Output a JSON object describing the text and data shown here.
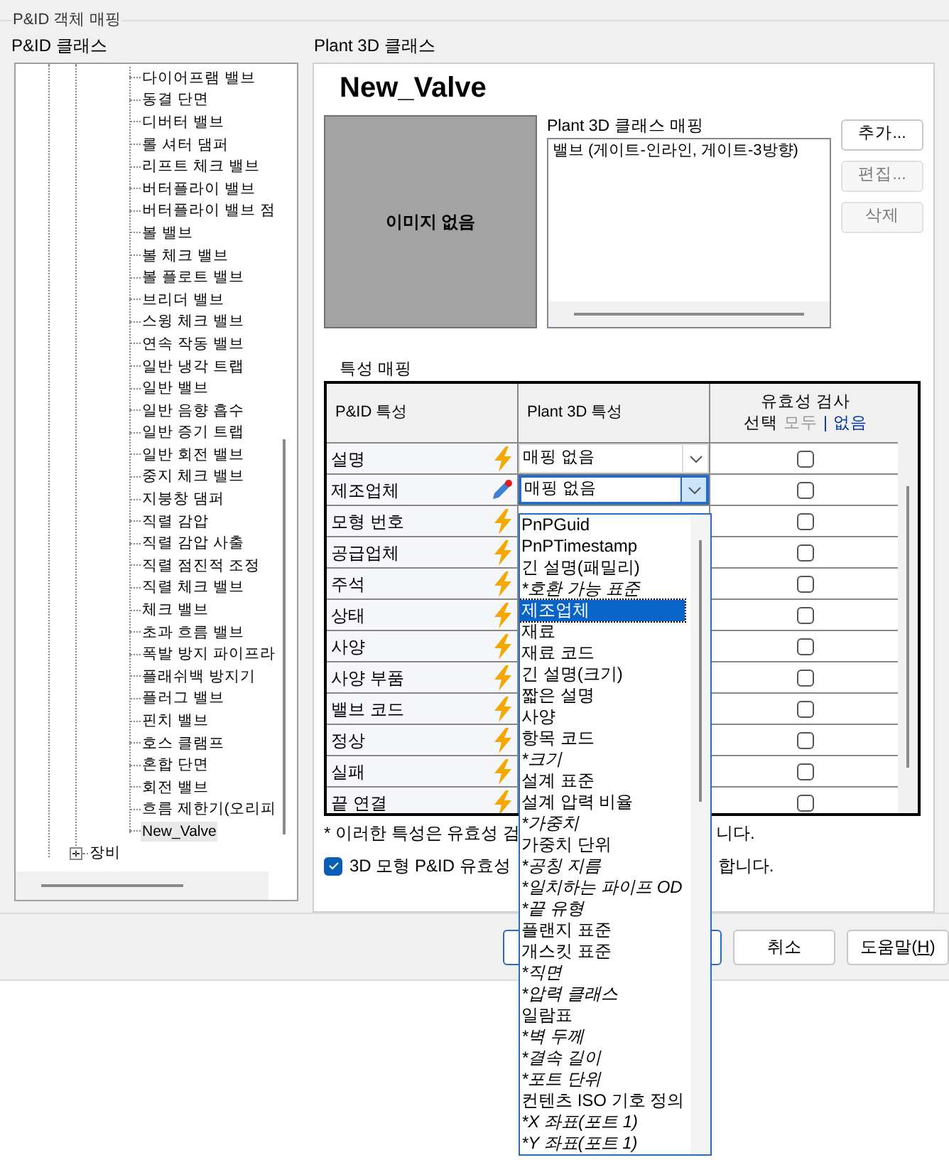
{
  "group_title": "P&ID 객체 매핑",
  "left": {
    "label": "P&ID 클래스",
    "tree": [
      {
        "children": [
          {
            "label": "다이어프램 밸브",
            "selected": false
          },
          {
            "label": "동결 단면",
            "selected": false
          },
          {
            "label": "디버터 밸브",
            "selected": false
          },
          {
            "label": "롤 셔터 댐퍼",
            "selected": false
          },
          {
            "label": "리프트 체크 밸브",
            "selected": false
          },
          {
            "label": "버터플라이 밸브",
            "selected": false
          },
          {
            "label": "버터플라이 밸브 점",
            "selected": false
          },
          {
            "label": "볼 밸브",
            "selected": false
          },
          {
            "label": "볼 체크 밸브",
            "selected": false
          },
          {
            "label": "볼 플로트 밸브",
            "selected": false
          },
          {
            "label": "브리더 밸브",
            "selected": false
          },
          {
            "label": "스윙 체크 밸브",
            "selected": false
          },
          {
            "label": "연속 작동 밸브",
            "selected": false
          },
          {
            "label": "일반 냉각 트랩",
            "selected": false
          },
          {
            "label": "일반 밸브",
            "selected": false
          },
          {
            "label": "일반 음향 흡수",
            "selected": false
          },
          {
            "label": "일반 증기 트랩",
            "selected": false
          },
          {
            "label": "일반 회전 밸브",
            "selected": false
          },
          {
            "label": "중지 체크 밸브",
            "selected": false
          },
          {
            "label": "지붕창 댐퍼",
            "selected": false
          },
          {
            "label": "직렬 감압",
            "selected": false
          },
          {
            "label": "직렬 감압 사출",
            "selected": false
          },
          {
            "label": "직렬 점진적 조정",
            "selected": false
          },
          {
            "label": "직렬 체크 밸브",
            "selected": false
          },
          {
            "label": "체크 밸브",
            "selected": false
          },
          {
            "label": "초과 흐름 밸브",
            "selected": false
          },
          {
            "label": "폭발 방지 파이프라",
            "selected": false
          },
          {
            "label": "플래쉬백 방지기",
            "selected": false
          },
          {
            "label": "플러그 밸브",
            "selected": false
          },
          {
            "label": "핀치 밸브",
            "selected": false
          },
          {
            "label": "호스 클램프",
            "selected": false
          },
          {
            "label": "혼합 단면",
            "selected": false
          },
          {
            "label": "회전 밸브",
            "selected": false
          },
          {
            "label": "흐름 제한기(오리피",
            "selected": false
          },
          {
            "label": "New_Valve",
            "selected": true
          }
        ]
      },
      {
        "label": "장비",
        "expanded": false
      }
    ]
  },
  "right": {
    "label": "Plant 3D 클래스",
    "class_name": "New_Valve",
    "image_text": "이미지 없음",
    "mapping_label": "Plant 3D 클래스 매핑",
    "mapping_items": [
      "밸브 (게이트-인라인, 게이트-3방향)"
    ],
    "buttons": [
      {
        "label": "추가...",
        "disabled": false
      },
      {
        "label": "편집...",
        "disabled": true
      },
      {
        "label": "삭제",
        "disabled": true
      }
    ],
    "property_label": "특성 매핑",
    "table": {
      "columns": [
        "P&ID 특성",
        "Plant 3D 특성"
      ],
      "validation_header": {
        "title": "유효성 검사",
        "select_label": "선택",
        "all_link": {
          "label": "모두",
          "disabled": true
        },
        "separator": "|",
        "none_link": {
          "label": "없음",
          "disabled": false
        }
      },
      "rows": [
        {
          "name": "설명",
          "kind": "auto",
          "value": "매핑 없음",
          "active": false,
          "checked": false
        },
        {
          "name": "제조업체",
          "kind": "edited",
          "value": "매핑 없음",
          "active": true,
          "checked": false
        },
        {
          "name": "모형 번호",
          "kind": "auto",
          "checked": false
        },
        {
          "name": "공급업체",
          "kind": "auto",
          "checked": false
        },
        {
          "name": "주석",
          "kind": "auto",
          "checked": false
        },
        {
          "name": "상태",
          "kind": "auto",
          "checked": false
        },
        {
          "name": "사양",
          "kind": "auto",
          "checked": false
        },
        {
          "name": "사양 부품",
          "kind": "auto",
          "checked": false
        },
        {
          "name": "밸브 코드",
          "kind": "auto",
          "checked": false
        },
        {
          "name": "정상",
          "kind": "auto",
          "checked": false
        },
        {
          "name": "실패",
          "kind": "auto",
          "checked": false
        },
        {
          "name": "끝 연결",
          "kind": "auto",
          "checked": false
        }
      ]
    },
    "footnote": [
      "* 이러한 특성은 유효성 검",
      "니다."
    ],
    "option": {
      "checked": true,
      "label": [
        "3D 모형 P&ID 유효성",
        "합니다."
      ]
    }
  },
  "dialog_buttons": [
    {
      "label": "취소"
    },
    {
      "label": "도움말(",
      "hotkey": "H",
      "suffix": ")"
    }
  ],
  "dropdown": [
    {
      "label": "PnPGuid",
      "kind": "plain",
      "selected": false
    },
    {
      "label": "PnPTimestamp",
      "kind": "plain",
      "selected": false
    },
    {
      "label": "긴 설명(패밀리)",
      "kind": "plain",
      "selected": false
    },
    {
      "label": "*호환 가능 표준",
      "kind": "starred",
      "selected": false
    },
    {
      "label": "제조업체",
      "kind": "plain",
      "selected": true
    },
    {
      "label": "재료",
      "kind": "plain",
      "selected": false
    },
    {
      "label": "재료 코드",
      "kind": "plain",
      "selected": false
    },
    {
      "label": "긴 설명(크기)",
      "kind": "plain",
      "selected": false
    },
    {
      "label": "짧은 설명",
      "kind": "plain",
      "selected": false
    },
    {
      "label": "사양",
      "kind": "plain",
      "selected": false
    },
    {
      "label": "항목 코드",
      "kind": "plain",
      "selected": false
    },
    {
      "label": "*크기",
      "kind": "starred",
      "selected": false
    },
    {
      "label": "설계 표준",
      "kind": "plain",
      "selected": false
    },
    {
      "label": "설계 압력 비율",
      "kind": "plain",
      "selected": false
    },
    {
      "label": "*가중치",
      "kind": "starred",
      "selected": false
    },
    {
      "label": "가중치 단위",
      "kind": "plain",
      "selected": false
    },
    {
      "label": "*공칭 지름",
      "kind": "starred",
      "selected": false
    },
    {
      "label": "*일치하는 파이프 OD",
      "kind": "starred",
      "selected": false
    },
    {
      "label": "*끝 유형",
      "kind": "starred",
      "selected": false
    },
    {
      "label": "플랜지 표준",
      "kind": "plain",
      "selected": false
    },
    {
      "label": "개스킷 표준",
      "kind": "plain",
      "selected": false
    },
    {
      "label": "*직면",
      "kind": "starred",
      "selected": false
    },
    {
      "label": "*압력 클래스",
      "kind": "starred",
      "selected": false
    },
    {
      "label": "일람표",
      "kind": "plain",
      "selected": false
    },
    {
      "label": "*벽 두께",
      "kind": "starred",
      "selected": false
    },
    {
      "label": "*결속 길이",
      "kind": "starred",
      "selected": false
    },
    {
      "label": "*포트 단위",
      "kind": "starred",
      "selected": false
    },
    {
      "label": "컨텐츠 ISO 기호 정의",
      "kind": "plain",
      "selected": false
    },
    {
      "label": "*X 좌표(포트 1)",
      "kind": "starred",
      "selected": false
    },
    {
      "label": "*Y 좌표(포트 1)",
      "kind": "starred",
      "selected": false
    }
  ]
}
